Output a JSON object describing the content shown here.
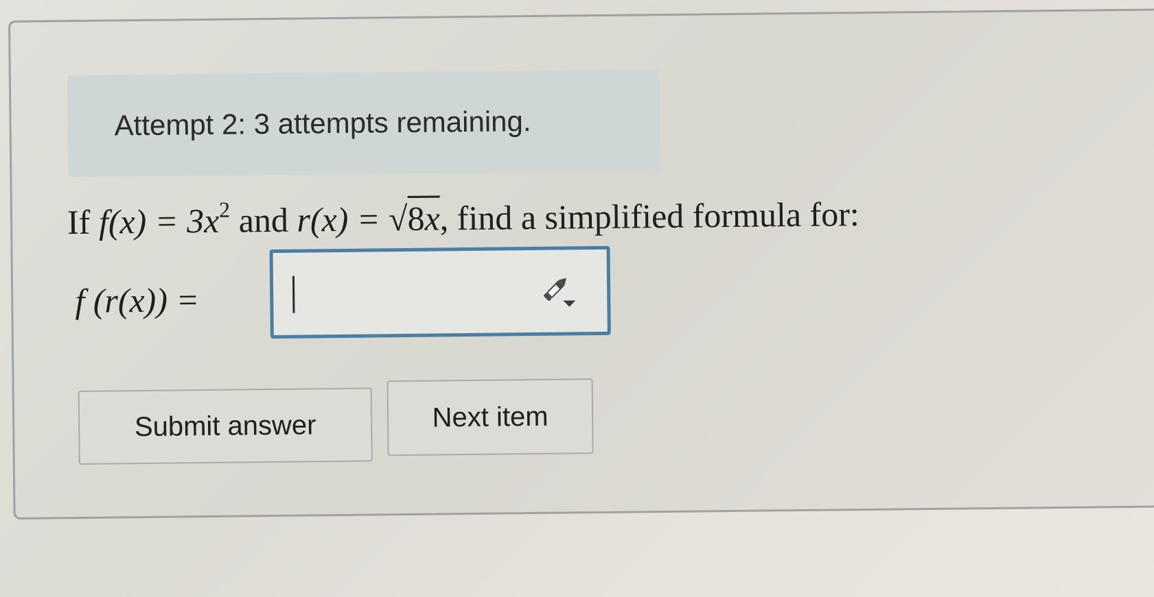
{
  "attempt": {
    "text": "Attempt 2: 3 attempts remaining."
  },
  "question": {
    "lead": "If ",
    "f_def": "f(x) = 3x",
    "f_exp": "2",
    "and": " and ",
    "r_def": "r(x) = ",
    "sqrt_arg_num": "8",
    "sqrt_arg_var": "x",
    "tail": ", find a simplified formula for:"
  },
  "formula": {
    "label": "f (r(x)) ="
  },
  "answer": {
    "value": "",
    "icon": "pencil-dropdown-icon"
  },
  "buttons": {
    "submit": "Submit answer",
    "next": "Next item"
  }
}
